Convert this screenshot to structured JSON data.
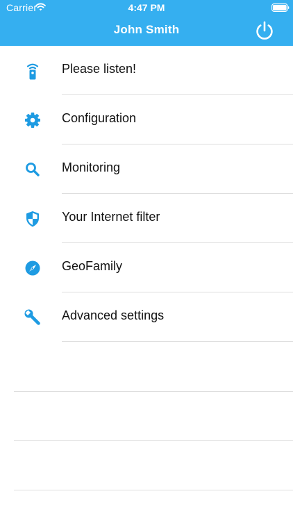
{
  "status_bar": {
    "carrier": "Carrier",
    "time": "4:47 PM"
  },
  "nav": {
    "title": "John Smith",
    "power_icon": "power-icon"
  },
  "menu": {
    "items": [
      {
        "label": "Please listen!",
        "icon": "remote-icon"
      },
      {
        "label": "Configuration",
        "icon": "gear-icon"
      },
      {
        "label": "Monitoring",
        "icon": "search-icon"
      },
      {
        "label": "Your Internet filter",
        "icon": "shield-icon"
      },
      {
        "label": "GeoFamily",
        "icon": "compass-icon"
      },
      {
        "label": "Advanced settings",
        "icon": "wrench-icon"
      }
    ]
  },
  "colors": {
    "accent": "#35aff0",
    "icon": "#1e9be2",
    "text": "#111111",
    "separator": "#dedede"
  }
}
